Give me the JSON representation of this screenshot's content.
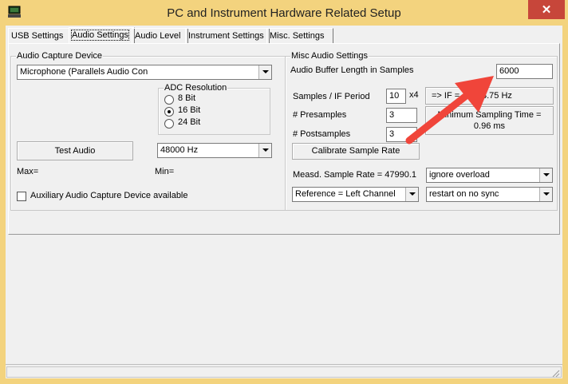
{
  "window": {
    "title": "PC and Instrument Hardware Related Setup",
    "close": "✕"
  },
  "tabs": [
    "USB Settings",
    "Audio Settings",
    "Audio Level",
    "Instrument Settings",
    "Misc. Settings"
  ],
  "audio_capture": {
    "group_label": "Audio Capture Device",
    "device_value": "Microphone (Parallels Audio Con",
    "adc_label": "ADC Resolution",
    "adc_options": [
      "8 Bit",
      "16 Bit",
      "24 Bit"
    ],
    "adc_selected": "16 Bit",
    "test_audio_label": "Test Audio",
    "sample_rate_value": "48000 Hz",
    "max_label": "Max=",
    "min_label": "Min=",
    "aux_label": "Auxiliary Audio Capture Device available"
  },
  "misc_audio": {
    "group_label": "Misc Audio Settings",
    "buffer_label": "Audio Buffer Length in Samples",
    "buffer_value": "6000",
    "samples_if_label": "Samples / IF Period",
    "samples_if_value": "10",
    "multiplier": "x4",
    "if_button_left": "=> IF =",
    "if_button_right": "3.75 Hz",
    "presamples_label": "# Presamples",
    "presamples_value": "3",
    "postsamples_label": "# Postsamples",
    "postsamples_value": "3",
    "min_sampling_line1": "Minimum Sampling Time =",
    "min_sampling_line2": "0.96 ms",
    "calibrate_label": "Calibrate Sample Rate",
    "measured_rate": "Measd. Sample Rate = 47990.1",
    "overload_value": "ignore overload",
    "reference_value": "Reference = Left Channel",
    "sync_value": "restart on no sync"
  },
  "colors": {
    "window_frame": "#f3d37e",
    "close_button": "#c7463a",
    "annotation_arrow": "#f0453a"
  }
}
